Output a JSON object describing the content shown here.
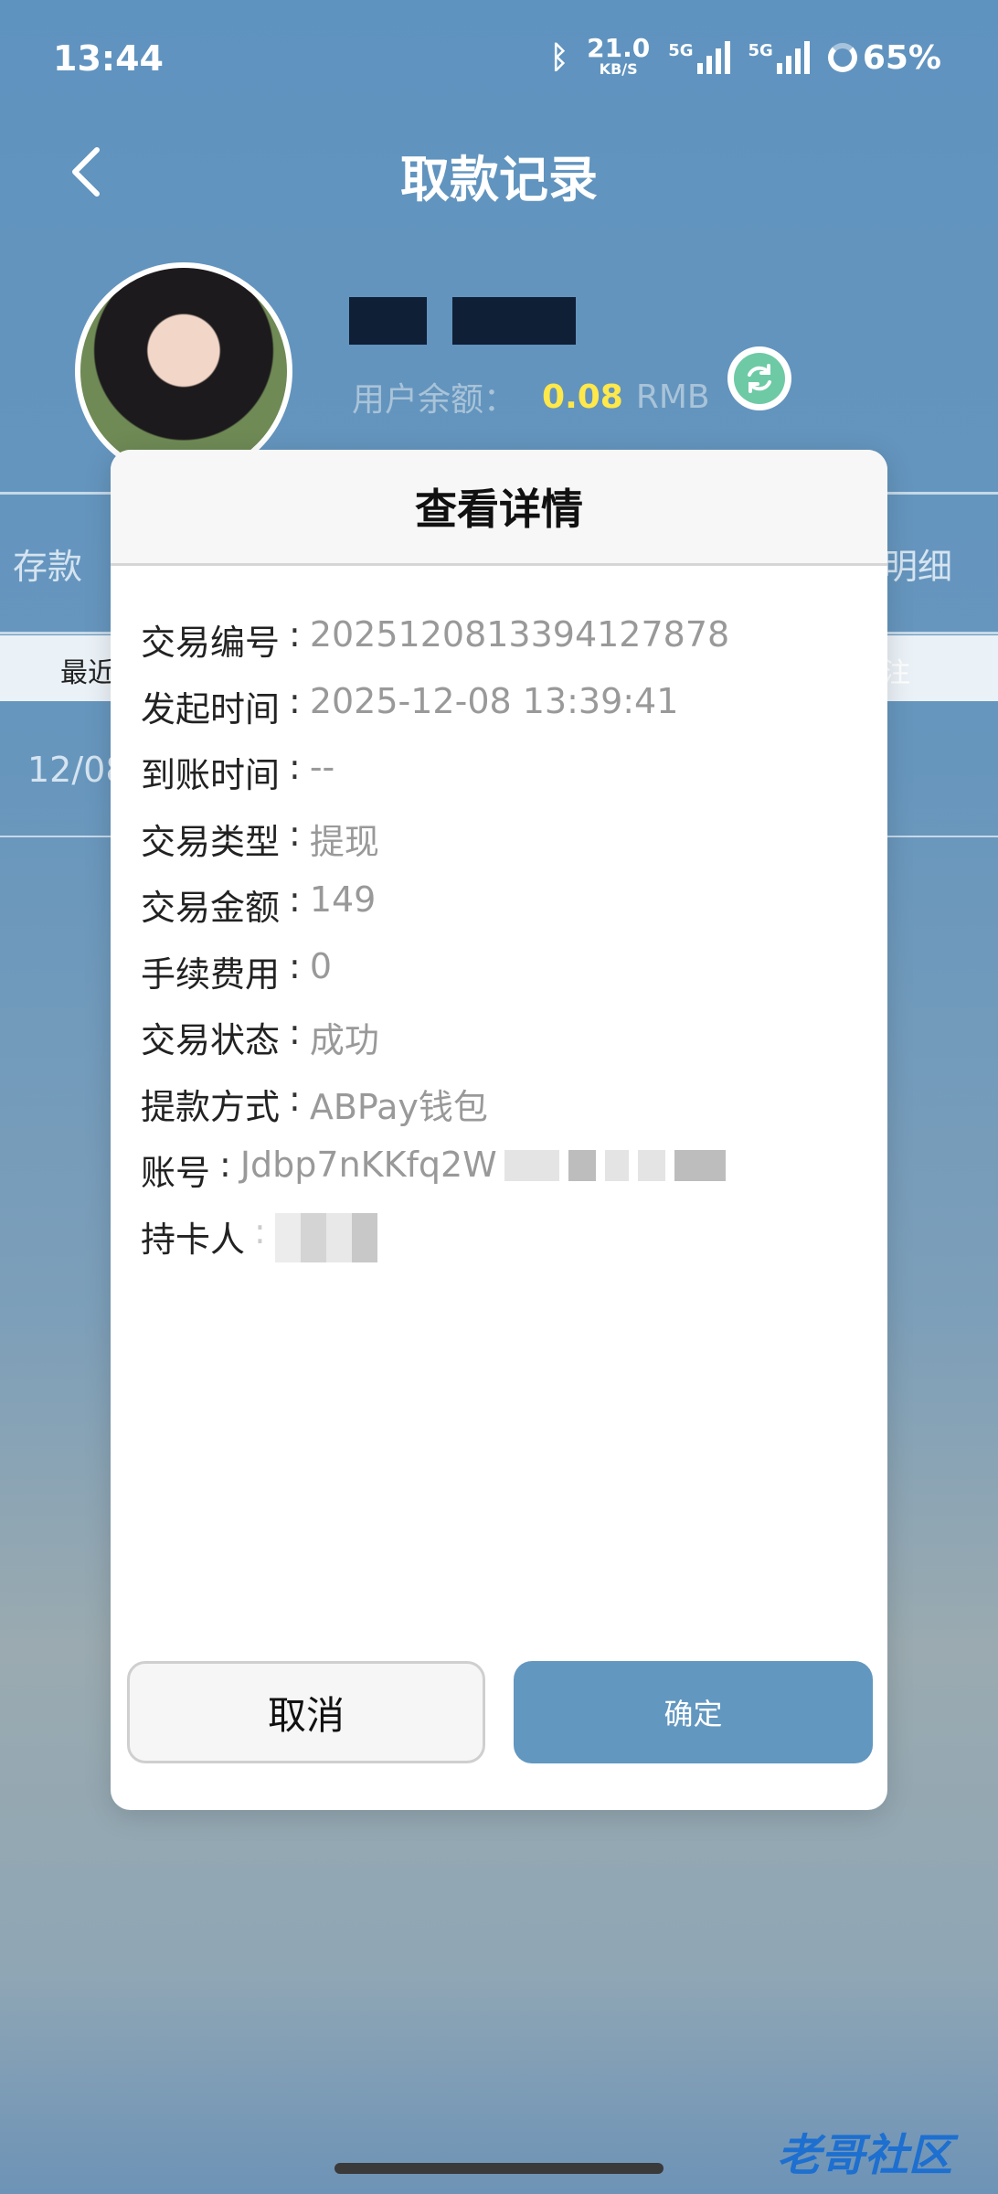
{
  "status_bar": {
    "time": "13:44",
    "speed_value": "21.0",
    "speed_unit": "KB/S",
    "net1": "5G",
    "net2": "5G",
    "battery": "65%"
  },
  "header": {
    "title": "取款记录"
  },
  "profile": {
    "balance_label": "用户余额：",
    "balance_value": "0.08",
    "balance_unit": "RMB"
  },
  "background": {
    "tab_left": "存款",
    "tab_right": "明细",
    "col_left": "最近",
    "col_right": "注",
    "row_date": "12/08"
  },
  "modal": {
    "title": "查看详情",
    "rows": [
      {
        "label": "交易编号",
        "value": "2025120813394127878"
      },
      {
        "label": "发起时间",
        "value": "2025-12-08 13:39:41"
      },
      {
        "label": "到账时间",
        "value": "--"
      },
      {
        "label": "交易类型",
        "value": "提现"
      },
      {
        "label": "交易金额",
        "value": "149"
      },
      {
        "label": "手续费用",
        "value": "0"
      },
      {
        "label": "交易状态",
        "value": "成功"
      },
      {
        "label": "提款方式",
        "value": "ABPay钱包"
      },
      {
        "label": "账号",
        "value": "Jdbp7nKKfq2W"
      },
      {
        "label": "持卡人",
        "value": ""
      }
    ],
    "cancel_label": "取消",
    "ok_label": "确定"
  },
  "watermark": "老哥社区",
  "colors": {
    "accent": "#6297c0",
    "balance": "#ffe84a",
    "refresh": "#6dcaa5"
  },
  "icons": [
    "back-icon",
    "bluetooth-icon",
    "signal-icon",
    "battery-icon",
    "refresh-icon"
  ]
}
